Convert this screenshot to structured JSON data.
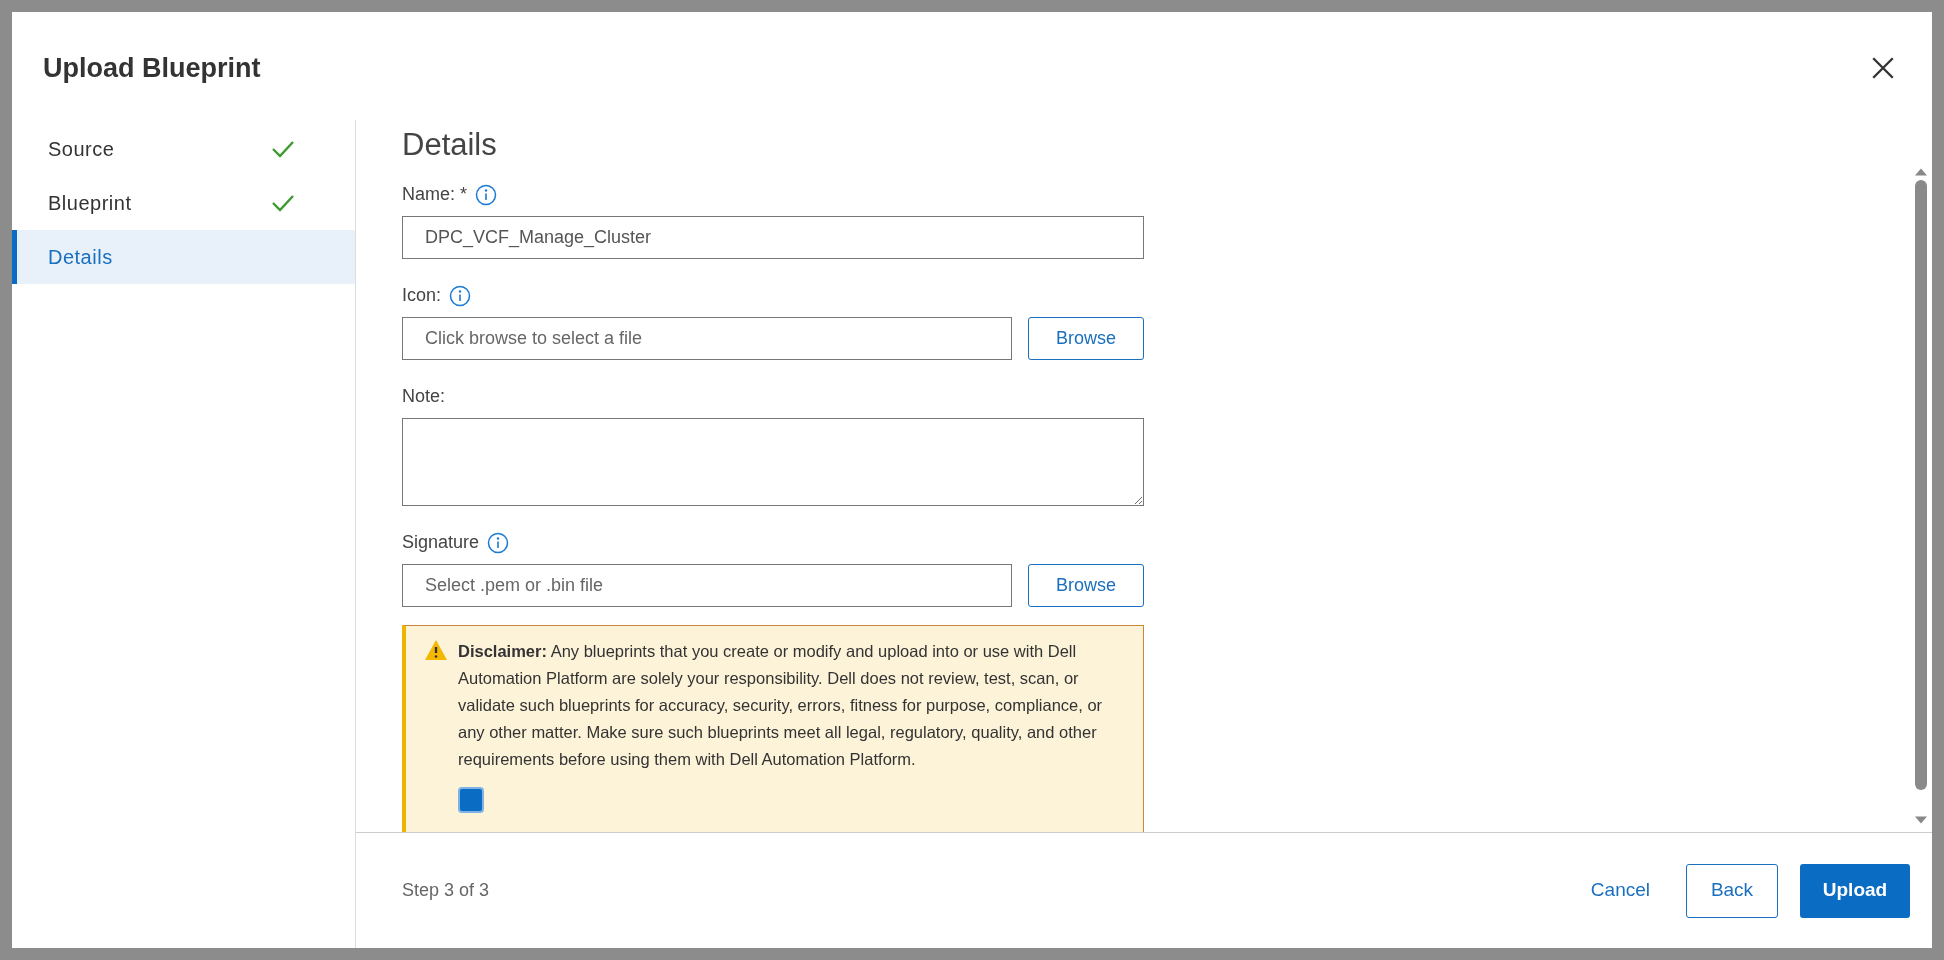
{
  "dialog": {
    "title": "Upload Blueprint"
  },
  "steps": [
    {
      "label": "Source",
      "completed": true,
      "selected": false
    },
    {
      "label": "Blueprint",
      "completed": true,
      "selected": false
    },
    {
      "label": "Details",
      "completed": false,
      "selected": true
    }
  ],
  "section": {
    "title": "Details"
  },
  "fields": [
    {
      "kind": "text",
      "label": "Name: *",
      "info": true,
      "value": "DPC_VCF_Manage_Cluster"
    },
    {
      "kind": "file",
      "label": "Icon:",
      "info": true,
      "placeholder": "Click browse to select a file",
      "button": "Browse"
    },
    {
      "kind": "textarea",
      "label": "Note:",
      "info": false
    },
    {
      "kind": "file",
      "label": "Signature",
      "info": true,
      "placeholder": "Select .pem or .bin file",
      "button": "Browse"
    }
  ],
  "disclaimer": {
    "text": "**Disclaimer:** Any blueprints that you create or modify and upload into or use with Dell Automation Platform are solely your responsibility. Dell does not review, test, scan, or validate such blueprints for accuracy, security, errors, fitness for purpose, compliance, or any other matter. Make sure such blueprints meet all legal, regulatory, quality, and other requirements before using them with Dell Automation Platform.",
    "acknowledge": {
      "checked": true
    }
  },
  "footer": {
    "step": "Step 3 of 3",
    "buttons": [
      {
        "label": "Cancel",
        "kind": "link"
      },
      {
        "label": "Back",
        "kind": "outline"
      },
      {
        "label": "Upload",
        "kind": "primary"
      }
    ]
  }
}
